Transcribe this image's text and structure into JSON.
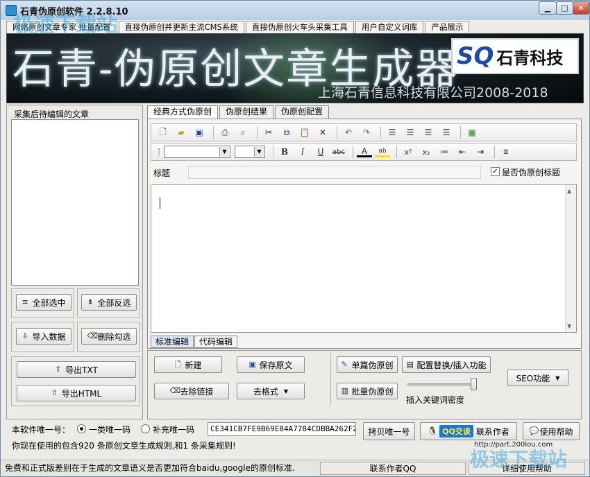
{
  "window": {
    "title": "石青伪原创软件 2.2.8.10"
  },
  "menu": [
    "网络原创文章专家 批量配置",
    "直接伪原创并更新主流CMS系统",
    "直接伪原创火车头采集工具",
    "用户自定义词库",
    "产品展示"
  ],
  "banner": {
    "title": "石青-伪原创文章生成器",
    "logo_mark": "SQ",
    "logo_name": "石青科技",
    "subtitle": "上海石青信息科技有限公司2008-2018"
  },
  "left_panel": {
    "group_label": "采集后待编辑的文章",
    "select_all": "全部选中",
    "invert_select": "全部反选",
    "import_data": "导入数据",
    "delete_checked": "删除勾选",
    "export_txt": "导出TXT",
    "export_html": "导出HTML"
  },
  "tabs": [
    "经典方式伪原创",
    "伪原创结果",
    "伪原创配置"
  ],
  "editor": {
    "title_label": "标题",
    "title_value": "",
    "pseudo_title_checkbox": "是否伪原创标题",
    "pseudo_title_checked": true,
    "bottom_tabs": [
      "标准编辑",
      "代码编辑"
    ]
  },
  "actions": {
    "new": "新建",
    "save_original": "保存原文",
    "remove_links": "去除链接",
    "clear_format": "去格式",
    "single_pseudo": "单篇伪原创",
    "config_replace": "配置替换/插入功能",
    "batch_pseudo": "批量伪原创",
    "keyword_density_label": "插入关键词密度",
    "keyword_density": 0.95,
    "seo": "SEO功能"
  },
  "code_row": {
    "label": "本软件唯一号：",
    "option1": "一类唯一码",
    "option2": "补充唯一码",
    "code_value": "CE341CB7FE9B69E84A7784CDBBA262F2",
    "copy_button": "拷贝唯一号",
    "qq_badge": "QQ交谈",
    "contact_author": "联系作者",
    "help": "使用帮助"
  },
  "info_line": "你现在使用的包含920 条原创文章生成规则,和1 条采集规则!",
  "url": "http://part.200lou.com",
  "status": {
    "message": "免费和正式版差别在于生成的文章语义是否更加符合baidu,google的原创标准.",
    "contact_qq": "联系作者QQ",
    "help": "详细使用帮助"
  },
  "watermark": "极速下载站"
}
